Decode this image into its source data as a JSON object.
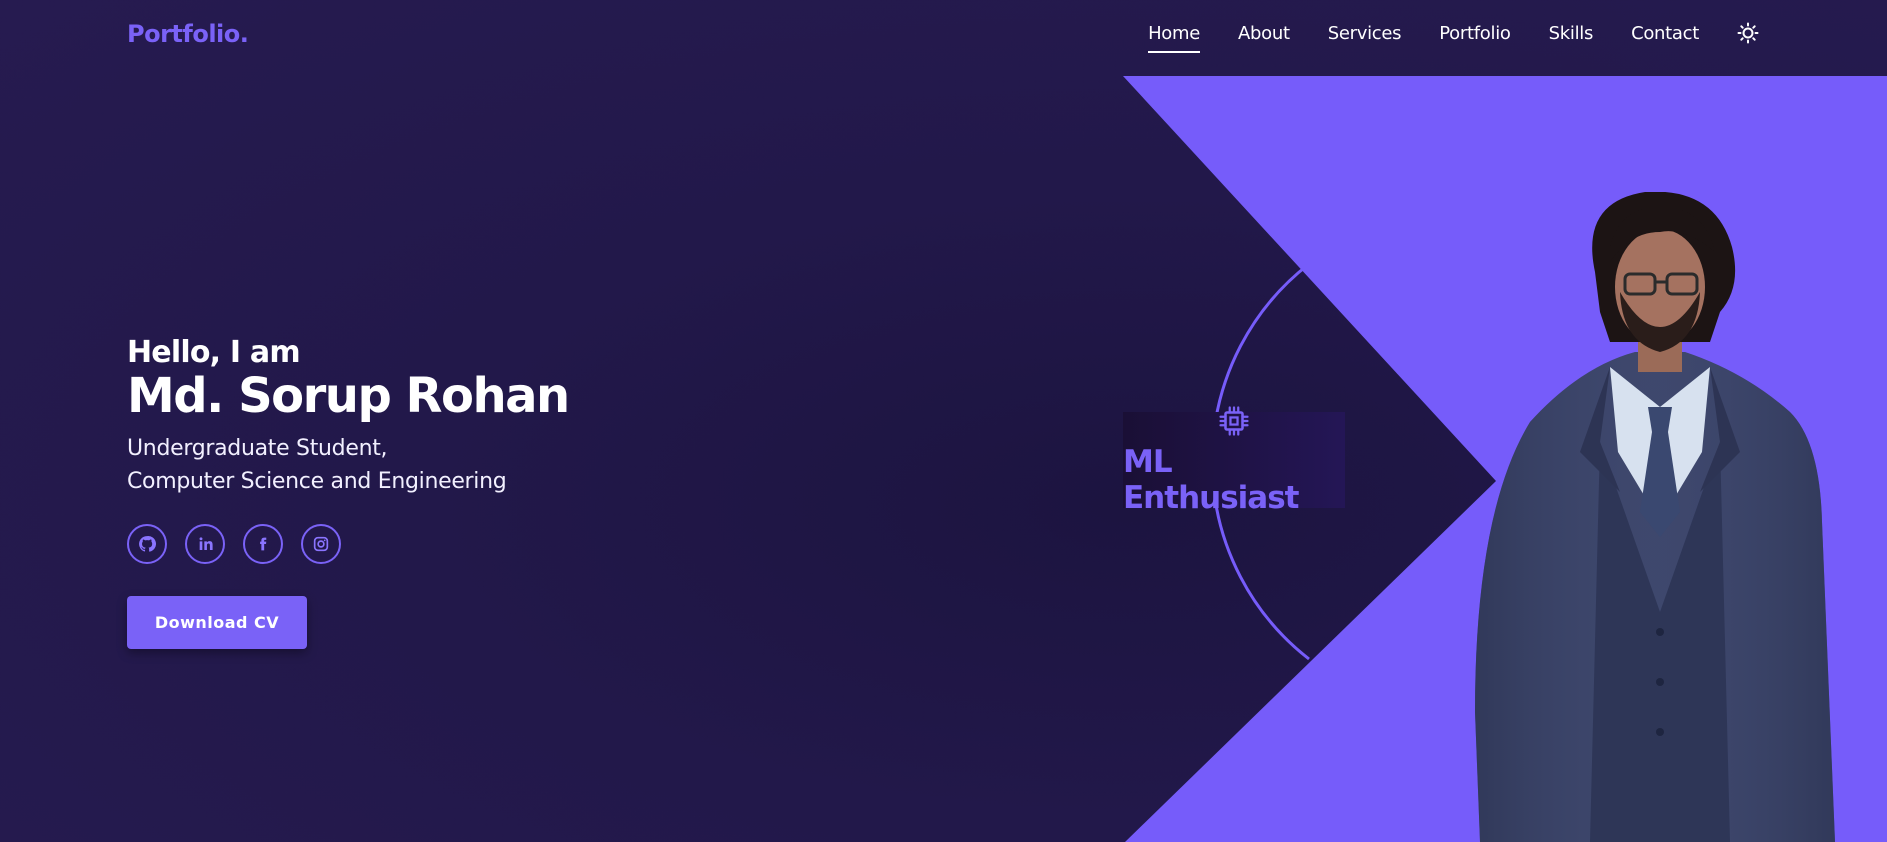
{
  "header": {
    "logo": "Portfolio.",
    "nav": [
      "Home",
      "About",
      "Services",
      "Portfolio",
      "Skills",
      "Contact"
    ],
    "active": "Home",
    "theme_icon": "sun-icon"
  },
  "hero": {
    "greeting": "Hello, I am",
    "name": "Md. Sorup Rohan",
    "subtitle_line1": "Undergraduate Student,",
    "subtitle_line2": "Computer Science and Engineering",
    "socials": [
      {
        "icon": "github-icon"
      },
      {
        "icon": "linkedin-icon"
      },
      {
        "icon": "facebook-icon"
      },
      {
        "icon": "instagram-icon"
      }
    ],
    "cta": "Download CV"
  },
  "badge": {
    "icon": "chip-icon",
    "label": "ML Enthusiast"
  },
  "colors": {
    "accent": "#7a62f7",
    "background": "#22184a",
    "panel": "#765cfa"
  }
}
